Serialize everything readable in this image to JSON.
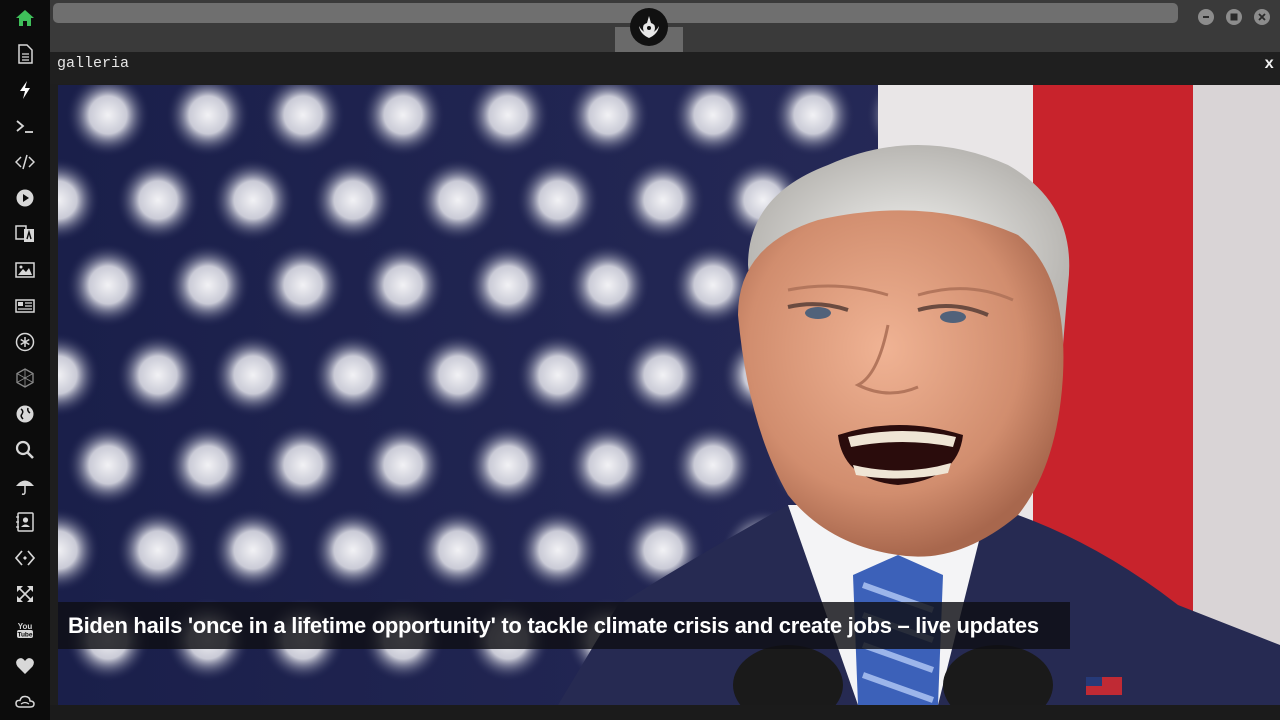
{
  "panel": {
    "title": "galleria",
    "close_label": "x"
  },
  "gallery": {
    "caption": "Biden hails 'once in a lifetime opportunity' to tackle climate crisis and create jobs – live updates"
  },
  "sidebar": {
    "items": [
      "home-icon",
      "file-icon",
      "bolt-icon",
      "terminal-icon",
      "code-icon",
      "play-icon",
      "translate-icon",
      "image-icon",
      "news-icon",
      "asterisk-icon",
      "network-icon",
      "globe-icon",
      "search-icon",
      "umbrella-icon",
      "contact-icon",
      "diamond-code-icon",
      "expand-icon",
      "youtube-icon",
      "heart-icon",
      "cloud-icon"
    ]
  },
  "colors": {
    "accent": "#3fbf5a",
    "sidebar_bg": "#0c0c0c",
    "topbar_bg": "#3a3a3a"
  }
}
